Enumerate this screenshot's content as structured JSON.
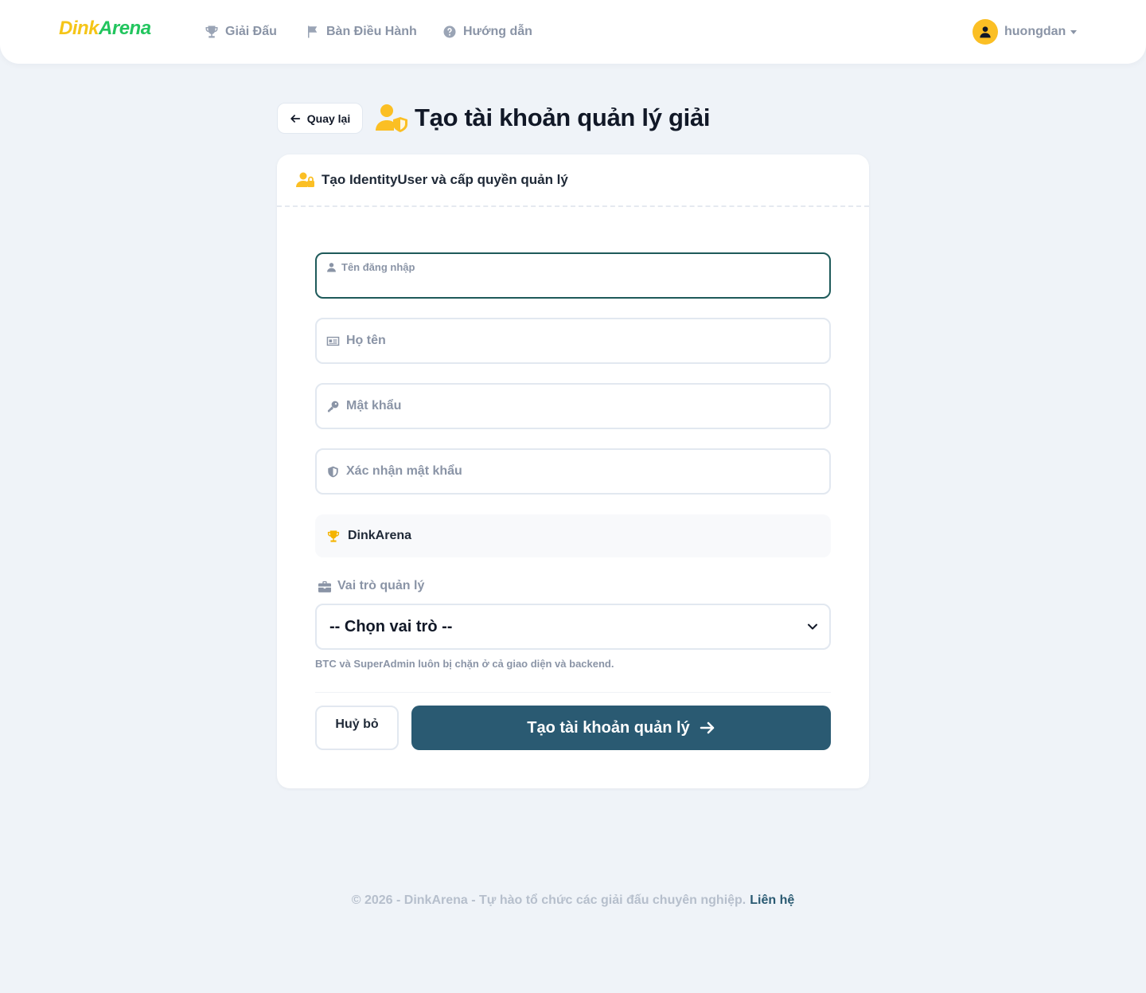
{
  "brand": {
    "part1": "Dink",
    "part2": "Arena"
  },
  "nav": {
    "items": [
      {
        "label": "Giải Đấu",
        "icon": "trophy-icon"
      },
      {
        "label": "Bàn Điều Hành",
        "icon": "flag-icon"
      },
      {
        "label": "Hướng dẫn",
        "icon": "question-circle-icon"
      }
    ],
    "user": {
      "name": "huongdan",
      "icon": "user-icon"
    }
  },
  "header": {
    "back_label": "Quay lại",
    "title": "Tạo tài khoản quản lý giải",
    "title_icon": "user-shield-icon"
  },
  "card": {
    "title": "Tạo IdentityUser và cấp quyền quản lý",
    "fields": {
      "username": {
        "label": "Tên đăng nhập",
        "value": "",
        "icon": "user-icon",
        "focused": true
      },
      "fullname": {
        "label": "Họ tên",
        "value": "",
        "icon": "id-card-icon"
      },
      "password": {
        "label": "Mật khẩu",
        "value": "",
        "icon": "key-icon"
      },
      "confirm_password": {
        "label": "Xác nhận mật khẩu",
        "value": "",
        "icon": "shield-icon"
      }
    },
    "tournament": {
      "name": "DinkArena",
      "icon": "trophy-icon"
    },
    "role": {
      "label": "Vai trò quản lý",
      "icon": "briefcase-icon",
      "selected": "-- Chọn vai trò --",
      "hint": "BTC và SuperAdmin luôn bị chặn ở cả giao diện và backend."
    },
    "cancel_label": "Huỷ bỏ",
    "submit_label": "Tạo tài khoản quản lý"
  },
  "footer": {
    "text": "© 2026 - DinkArena - Tự hào tổ chức các giải đấu chuyên nghiệp.",
    "link": "Liên hệ"
  },
  "colors": {
    "background": "#eff3f8",
    "primary": "#2a5a72",
    "accent_yellow": "#fbbf24",
    "brand_green": "#22c55e",
    "focus_border": "#1e5a5a"
  }
}
